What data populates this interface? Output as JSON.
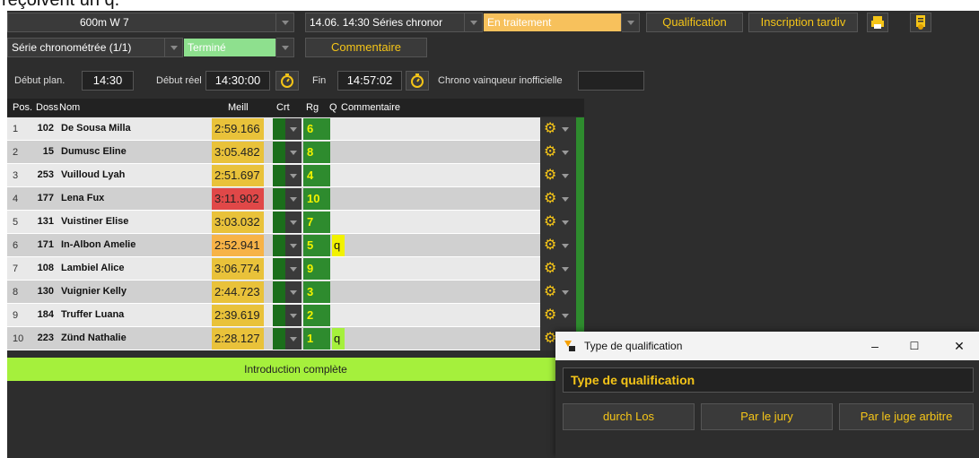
{
  "caption": "reçoivent un q.",
  "top": {
    "event_select": "600m W 7",
    "series_select": "14.06. 14:30 Séries chronor",
    "series_status": "En traitement",
    "qualification_button": "Qualification",
    "late_entry_button": "Inscription tardiv",
    "heat_select": "Série chronométrée (1/1)",
    "heat_status": "Terminé",
    "comment_button": "Commentaire"
  },
  "colors": {
    "accent": "#f5c518",
    "status_processing": "#f7c15c",
    "status_done": "#8ee08e",
    "best_normal": "#e9c23a",
    "best_orange": "#f7b347",
    "best_red": "#e04848",
    "rank_bg": "#2e8b2e",
    "rank_text": "#f2f200",
    "complete_bar": "#a5f03c"
  },
  "times": {
    "start_planned_label": "Début plan.",
    "start_planned": "14:30",
    "start_real_label": "Début réel",
    "start_real": "14:30:00",
    "end_label": "Fin",
    "end": "14:57:02",
    "unofficial_winner_label": "Chrono vainqueur inofficielle",
    "unofficial_winner": ""
  },
  "grid": {
    "headers": {
      "pos": "Pos.",
      "doss": "Doss",
      "name": "Nom",
      "best": "Meill",
      "crt": "Crt",
      "rank": "Rg",
      "q": "Q",
      "comment": "Commentaire"
    },
    "rows": [
      {
        "pos": "1",
        "doss": "102",
        "name": "De Sousa Milla",
        "best": "2:59.166",
        "best_color": "#e9c23a",
        "rank": "6",
        "q": ""
      },
      {
        "pos": "2",
        "doss": "15",
        "name": "Dumusc Eline",
        "best": "3:05.482",
        "best_color": "#e9c23a",
        "rank": "8",
        "q": ""
      },
      {
        "pos": "3",
        "doss": "253",
        "name": "Vuilloud Lyah",
        "best": "2:51.697",
        "best_color": "#e9c23a",
        "rank": "4",
        "q": ""
      },
      {
        "pos": "4",
        "doss": "177",
        "name": "Lena Fux",
        "best": "3:11.902",
        "best_color": "#e04848",
        "rank": "10",
        "q": ""
      },
      {
        "pos": "5",
        "doss": "131",
        "name": "Vuistiner Elise",
        "best": "3:03.032",
        "best_color": "#e9c23a",
        "rank": "7",
        "q": ""
      },
      {
        "pos": "6",
        "doss": "171",
        "name": "In-Albon Amelie",
        "best": "2:52.941",
        "best_color": "#f7b347",
        "rank": "5",
        "q": "q"
      },
      {
        "pos": "7",
        "doss": "108",
        "name": "Lambiel Alice",
        "best": "3:06.774",
        "best_color": "#e9c23a",
        "rank": "9",
        "q": ""
      },
      {
        "pos": "8",
        "doss": "130",
        "name": "Vuignier Kelly",
        "best": "2:44.723",
        "best_color": "#e9c23a",
        "rank": "3",
        "q": ""
      },
      {
        "pos": "9",
        "doss": "184",
        "name": "Truffer Luana",
        "best": "2:39.619",
        "best_color": "#e9c23a",
        "rank": "2",
        "q": ""
      },
      {
        "pos": "10",
        "doss": "223",
        "name": "Zünd Nathalie",
        "best": "2:28.127",
        "best_color": "#e9c23a",
        "rank": "1",
        "q": "q"
      }
    ],
    "complete_label": "Introduction complète"
  },
  "dialog": {
    "title": "Type de qualification",
    "header": "Type de qualification",
    "buttons": [
      "durch Los",
      "Par le jury",
      "Par le juge arbitre"
    ],
    "minimize": "–",
    "maximize": "☐",
    "close": "✕"
  }
}
